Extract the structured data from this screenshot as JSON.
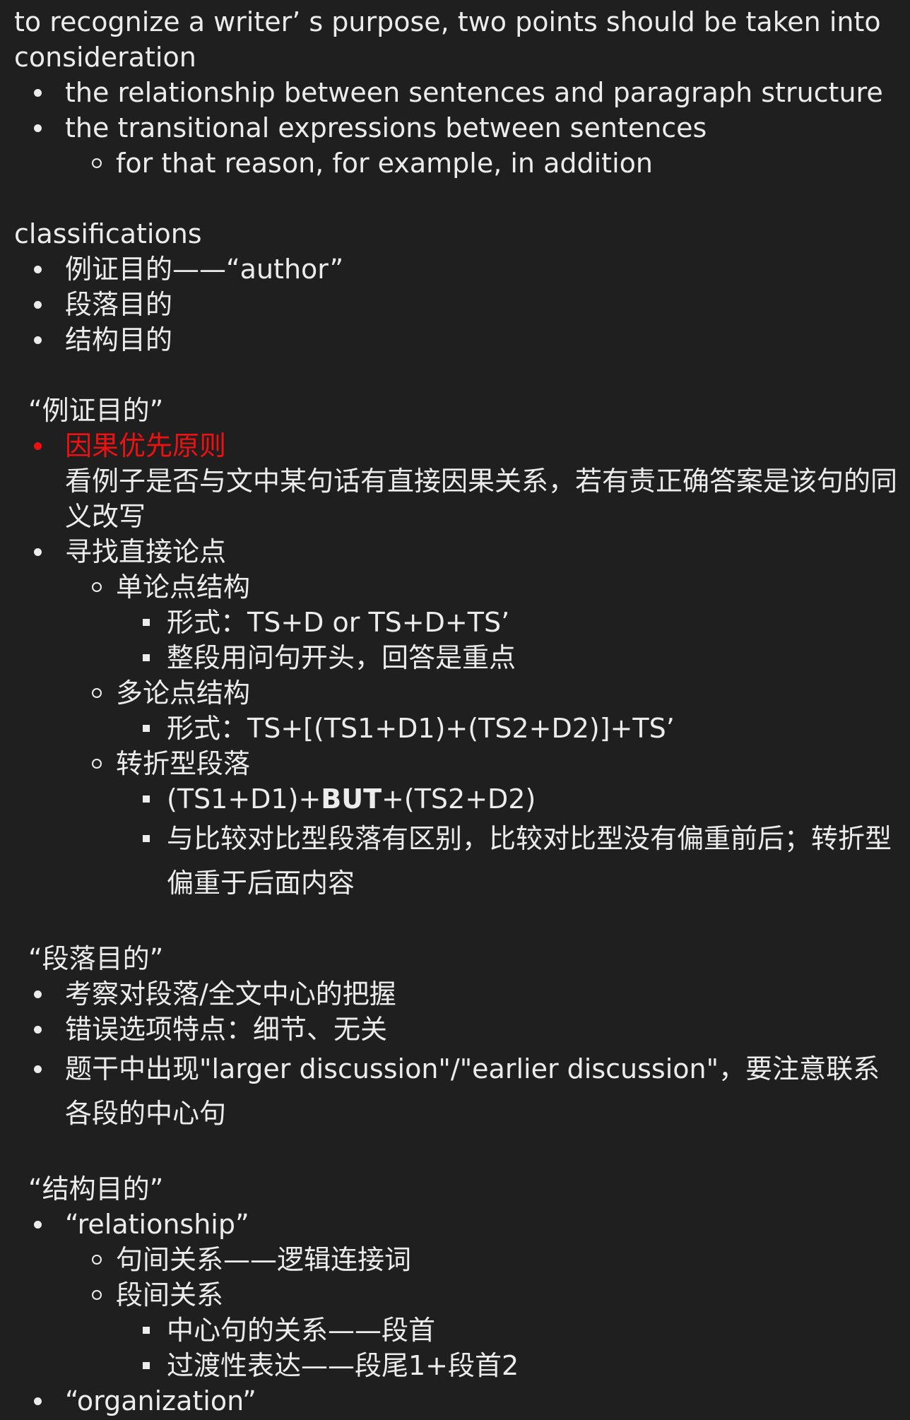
{
  "intro": {
    "line1": "to recognize a writer’ s purpose, two points should be taken into",
    "line2": "consideration",
    "points": [
      "the relationship between sentences and paragraph structure",
      "the transitional expressions between sentences"
    ],
    "sub_point": "for that reason, for example, in addition"
  },
  "classifications": {
    "title": "classifications",
    "items": [
      "例证目的——“author”",
      "段落目的",
      "结构目的"
    ]
  },
  "example_purpose": {
    "title": "“例证目的”",
    "rule_title": "因果优先原则",
    "rule_text": "看例子是否与文中某句话有直接因果关系，若有责正确答案是该句的同义改写",
    "find_point": "寻找直接论点",
    "single": {
      "label": "单论点结构",
      "items": [
        "形式：TS+D or TS+D+TS’",
        "整段用问句开头，回答是重点"
      ]
    },
    "multi": {
      "label": "多论点结构",
      "items": [
        "形式：TS+[(TS1+D1)+(TS2+D2)]+TS’"
      ]
    },
    "turn": {
      "label": "转折型段落",
      "formula_a": "(TS1+D1)+",
      "formula_bold": "BUT",
      "formula_b": "+(TS2+D2)",
      "note": "与比较对比型段落有区别，比较对比型没有偏重前后；转折型偏重于后面内容"
    }
  },
  "paragraph_purpose": {
    "title": "“段落目的”",
    "items": [
      "考察对段落/全文中心的把握",
      "错误选项特点：细节、无关",
      "题干中出现\"larger discussion\"/\"earlier discussion\"，要注意联系各段的中心句"
    ]
  },
  "structure_purpose": {
    "title": "“结构目的”",
    "relationship": " “relationship”",
    "sentence_rel": "句间关系——逻辑连接词",
    "paragraph_rel": "段间关系",
    "paragraph_rel_items": [
      "中心句的关系——段首",
      "过渡性表达——段尾1+段首2"
    ],
    "organization": " “organization”"
  },
  "colors": {
    "background": "#1f1f1f",
    "text": "#ececec",
    "highlight": "#ee1111"
  }
}
